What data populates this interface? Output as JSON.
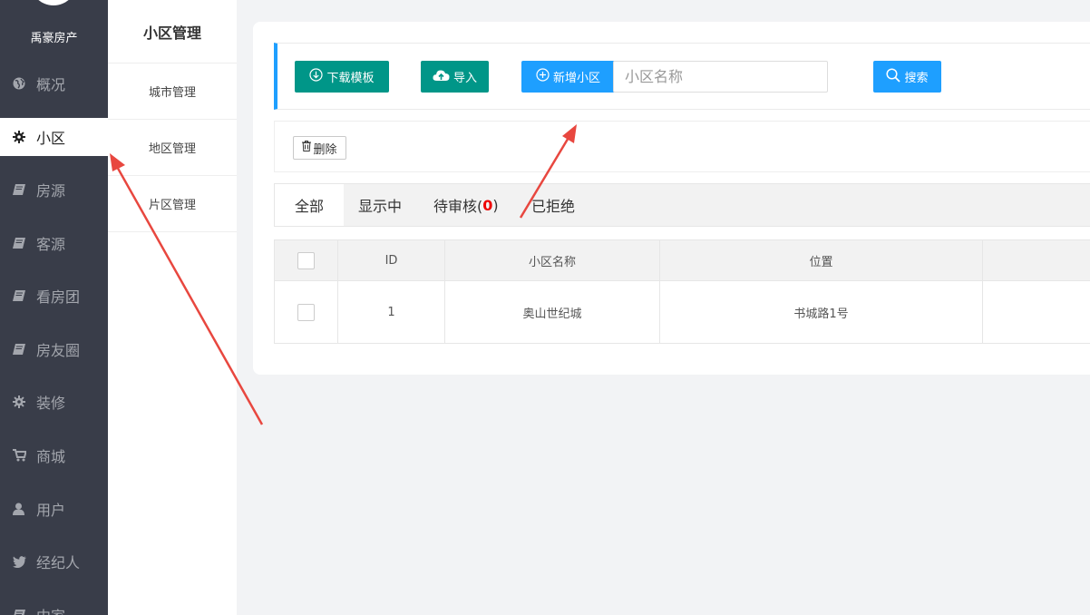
{
  "sidebar": {
    "brand": "禹豪房产",
    "items": [
      {
        "label": "概况",
        "icon": "globe-icon"
      },
      {
        "label": "小区",
        "icon": "gear-icon",
        "active": true
      },
      {
        "label": "房源",
        "icon": "book-icon"
      },
      {
        "label": "客源",
        "icon": "book-icon"
      },
      {
        "label": "看房团",
        "icon": "book-icon"
      },
      {
        "label": "房友圈",
        "icon": "book-icon"
      },
      {
        "label": "装修",
        "icon": "gear-icon"
      },
      {
        "label": "商城",
        "icon": "cart-icon"
      },
      {
        "label": "用户",
        "icon": "user-icon"
      },
      {
        "label": "经纪人",
        "icon": "twitter-icon"
      },
      {
        "label": "中家",
        "icon": "book-icon"
      }
    ]
  },
  "submenu": {
    "title": "小区管理",
    "items": [
      "城市管理",
      "地区管理",
      "片区管理"
    ]
  },
  "toolbar": {
    "download_label": "下载模板",
    "import_label": "导入",
    "add_label": "新增小区",
    "search_placeholder": "小区名称",
    "search_label": "搜索"
  },
  "ops": {
    "delete_label": "删除"
  },
  "tabs": {
    "all": "全部",
    "showing": "显示中",
    "pending_prefix": "待审核(",
    "pending_count": "0",
    "pending_suffix": ")",
    "rejected": "已拒绝"
  },
  "table": {
    "headers": [
      "ID",
      "小区名称",
      "位置"
    ],
    "rows": [
      {
        "id": "1",
        "name": "奥山世纪城",
        "location": "书城路1号"
      }
    ]
  },
  "colors": {
    "sidebar_bg": "#393d49",
    "green": "#009688",
    "blue": "#1e9fff",
    "arrow": "#e8473f"
  }
}
